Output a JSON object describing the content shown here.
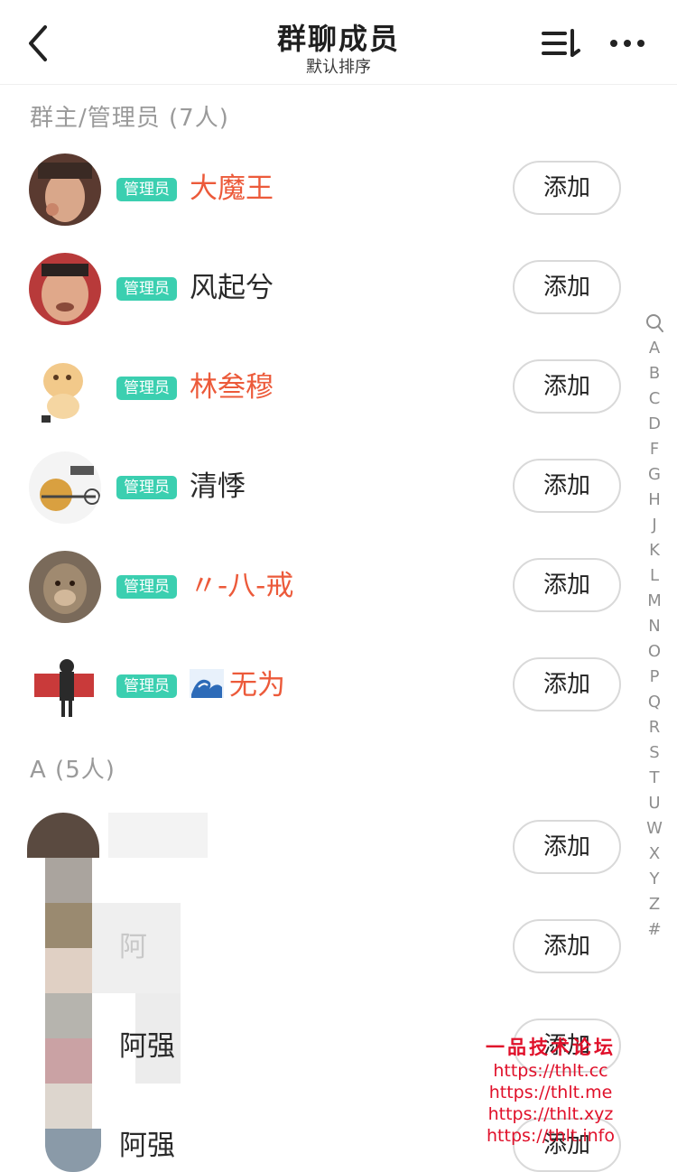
{
  "header": {
    "title": "群聊成员",
    "subtitle": "默认排序"
  },
  "icons": [
    "back-icon",
    "sort-icon",
    "more-icon",
    "search-icon",
    "wave-emoji-icon"
  ],
  "sections": {
    "admins_header": "群主/管理员 (7人)",
    "a_header": "A (5人)"
  },
  "admins": [
    {
      "badge": "管理员",
      "name": "大魔王",
      "action": "添加",
      "name_color": "#ec5a3a"
    },
    {
      "badge": "管理员",
      "name": "风起兮",
      "action": "添加",
      "name_color": "#2a2a2a"
    },
    {
      "badge": "管理员",
      "name": "林叁穆",
      "action": "添加",
      "name_color": "#ec5a3a"
    },
    {
      "badge": "管理员",
      "name": "清悸",
      "action": "添加",
      "name_color": "#2a2a2a"
    },
    {
      "badge": "管理员",
      "name": "〃-八-戒",
      "action": "添加",
      "name_color": "#ec5a3a"
    },
    {
      "badge": "管理员",
      "name": "无为",
      "action": "添加",
      "name_color": "#ec5a3a"
    }
  ],
  "a_members": [
    {
      "name": "",
      "action": "添加"
    },
    {
      "name": "阿",
      "action": "添加"
    },
    {
      "name": "阿强",
      "action": "添加"
    },
    {
      "name": "阿强",
      "action": "添加"
    }
  ],
  "index_letters": [
    "A",
    "B",
    "C",
    "D",
    "F",
    "G",
    "H",
    "J",
    "K",
    "L",
    "M",
    "N",
    "O",
    "P",
    "Q",
    "R",
    "S",
    "T",
    "U",
    "W",
    "X",
    "Y",
    "Z",
    "#"
  ],
  "watermark": {
    "title": "一品技术论坛",
    "urls": [
      "https://thlt.cc",
      "https://thlt.me",
      "https://thlt.xyz",
      "https://thlt.info"
    ]
  },
  "colors": {
    "badge": "#3bcfb0",
    "red_name": "#ec5a3a",
    "section_text": "#9a9a9a",
    "watermark": "#e0102a"
  }
}
